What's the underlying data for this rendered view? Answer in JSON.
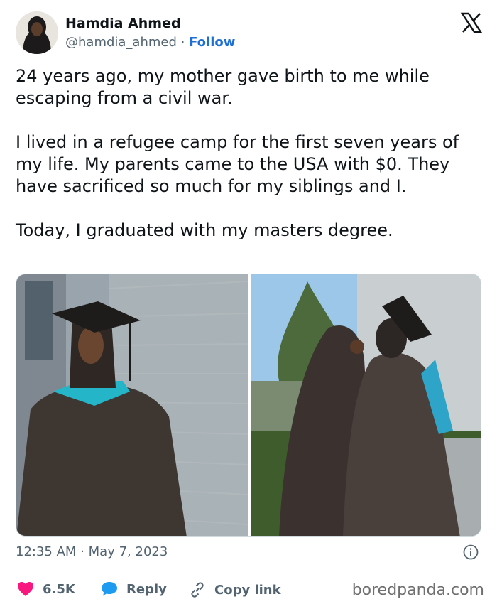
{
  "author": {
    "name": "Hamdia Ahmed",
    "handle": "@hamdia_ahmed",
    "separator": "·",
    "follow_label": "Follow"
  },
  "tweet": {
    "paragraphs": [
      "24 years ago, my mother gave birth to me while escaping from a civil war.",
      "I lived in a refugee camp for the first seven years of my life. My parents came to the USA with $0. They have sacrificed so much for my siblings and I.",
      "Today, I graduated with my masters degree."
    ]
  },
  "meta": {
    "time": "12:35 AM",
    "separator": "·",
    "date": "May 7, 2023"
  },
  "actions": {
    "like_count": "6.5K",
    "reply_label": "Reply",
    "copy_label": "Copy link"
  },
  "watermark": "boredpanda.com",
  "colors": {
    "like": "#f91880",
    "reply": "#1d9bf0",
    "follow": "#1d6fd6",
    "muted": "#536471"
  },
  "icons": {
    "logo": "x-logo-icon",
    "info": "info-icon",
    "like": "heart-icon",
    "reply": "speech-bubble-icon",
    "copy": "link-icon"
  }
}
